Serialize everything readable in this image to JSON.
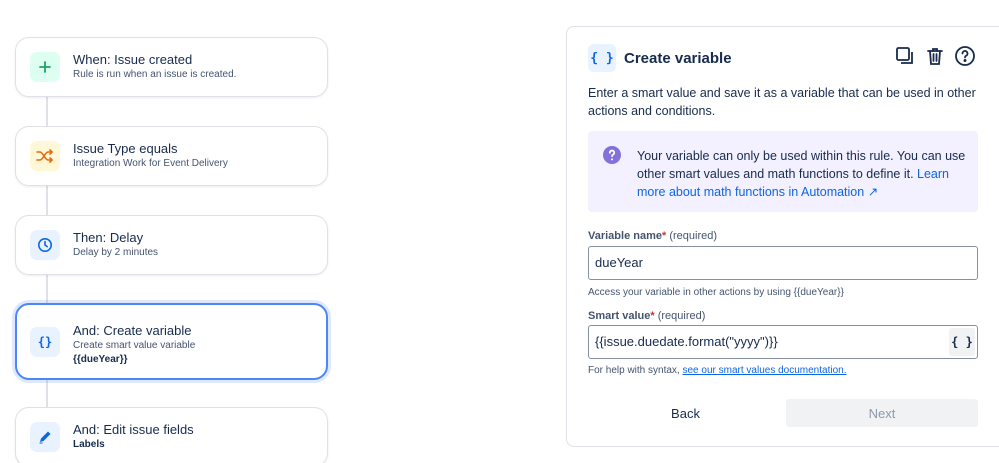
{
  "flow": {
    "steps": [
      {
        "title": "When: Issue created",
        "subtitle": "Rule is run when an issue is created.",
        "icon": "plus-icon",
        "color": "#22a06b",
        "bg": "#dcfff1"
      },
      {
        "title": "Issue Type equals",
        "subtitle": "Integration Work for Event Delivery",
        "icon": "shuffle-icon",
        "color": "#e56910",
        "bg": "#fff7d6"
      },
      {
        "title": "Then: Delay",
        "subtitle": "Delay by 2 minutes",
        "icon": "clock-icon",
        "color": "#0c66e4",
        "bg": "#e9f2ff"
      },
      {
        "title": "And: Create variable",
        "subtitle": "Create smart value variable",
        "subtitle2": "{{dueYear}}",
        "icon": "curly-braces-icon",
        "color": "#0c66e4",
        "bg": "#e9f2ff"
      },
      {
        "title": "And: Edit issue fields",
        "subtitle": "Labels",
        "icon": "pencil-icon",
        "color": "#0c66e4",
        "bg": "#e9f2ff"
      }
    ]
  },
  "panel": {
    "icon_text": "{ }",
    "title": "Create variable",
    "actions": [
      "duplicate-icon",
      "delete-icon",
      "help-icon"
    ],
    "intro": "Enter a smart value and save it as a variable that can be used in other actions and conditions.",
    "info": {
      "text": "Your variable can only be used within this rule. You can use other smart values and math functions to define it.",
      "link": "Learn more about math functions in Automation ↗"
    },
    "variable_name": {
      "label": "Variable name",
      "required_mark": "*",
      "required_text": "(required)",
      "value": "dueYear",
      "help": "Access your variable in other actions by using {{dueYear}}"
    },
    "smart_value": {
      "label": "Smart value",
      "required_mark": "*",
      "required_text": "(required)",
      "value": "{{issue.duedate.format(\"yyyy\")}}",
      "button": "{ }",
      "help_prefix": "For help with syntax,",
      "help_link": "see our smart values documentation."
    },
    "back_label": "Back",
    "next_label": "Next"
  },
  "colors": {
    "accent": "#0c66e4",
    "selected_border": "#4c86f9",
    "info_bg": "#f3f0ff",
    "info_icon": "#8270db"
  }
}
